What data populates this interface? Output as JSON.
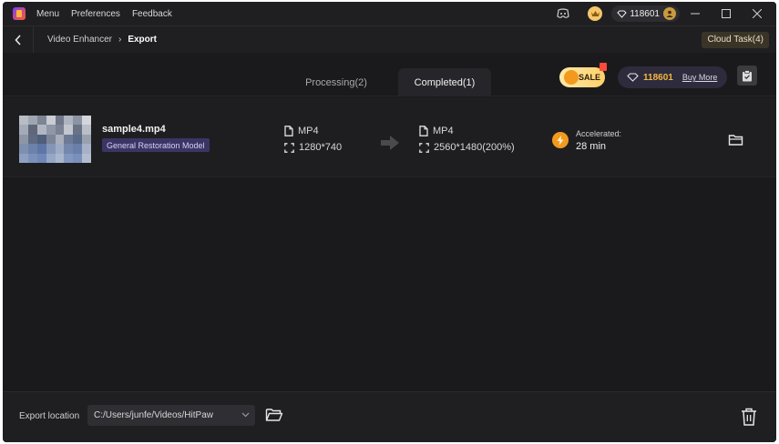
{
  "titlebar": {
    "menu_items": [
      "Menu",
      "Preferences",
      "Feedback"
    ],
    "points": "118601"
  },
  "breadcrumb": {
    "parent": "Video Enhancer",
    "current": "Export",
    "cloud_task": "Cloud Task(4)"
  },
  "tabs": {
    "processing": "Processing(2)",
    "completed": "Completed(1)"
  },
  "promo": {
    "sale_label": "SALE",
    "points": "118601",
    "buy_more": "Buy More"
  },
  "task": {
    "filename": "sample4.mp4",
    "model": "General Restoration Model",
    "input_format": "MP4",
    "input_resolution": "1280*740",
    "output_format": "MP4",
    "output_resolution": "2560*1480(200%)",
    "accelerated_label": "Accelerated:",
    "accelerated_time": "28 min"
  },
  "footer": {
    "export_label": "Export location",
    "export_path": "C:/Users/junfe/Videos/HitPaw"
  },
  "colors": {
    "window_bg": "#1a1a1c",
    "accent_gold": "#f4b63e",
    "model_tag_bg": "#3b3564"
  }
}
